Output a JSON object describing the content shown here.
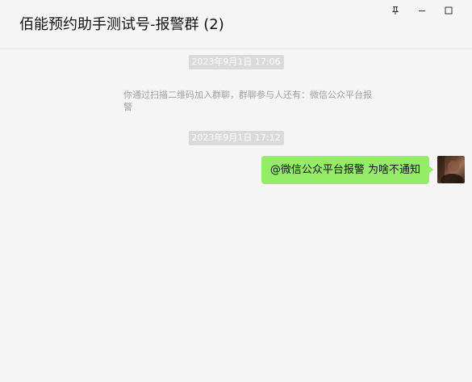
{
  "window": {
    "title": "佰能预约助手测试号-报警群 (2)",
    "controls": [
      "pin-icon",
      "minimize-icon",
      "maximize-icon"
    ]
  },
  "messages": {
    "timestamp_1": "2023年9月1日 17:06",
    "system_text": "你通过扫描二维码加入群聊，群聊参与人还有：微信公众平台报警",
    "timestamp_2": "2023年9月1日 17:12",
    "outgoing": {
      "text": "@微信公众平台报警  为啥不通知",
      "bubble_color": "#95ec69"
    }
  },
  "colors": {
    "background": "#f5f5f5",
    "timestamp_bg": "#dadada",
    "system_text": "#a0a0a0"
  }
}
